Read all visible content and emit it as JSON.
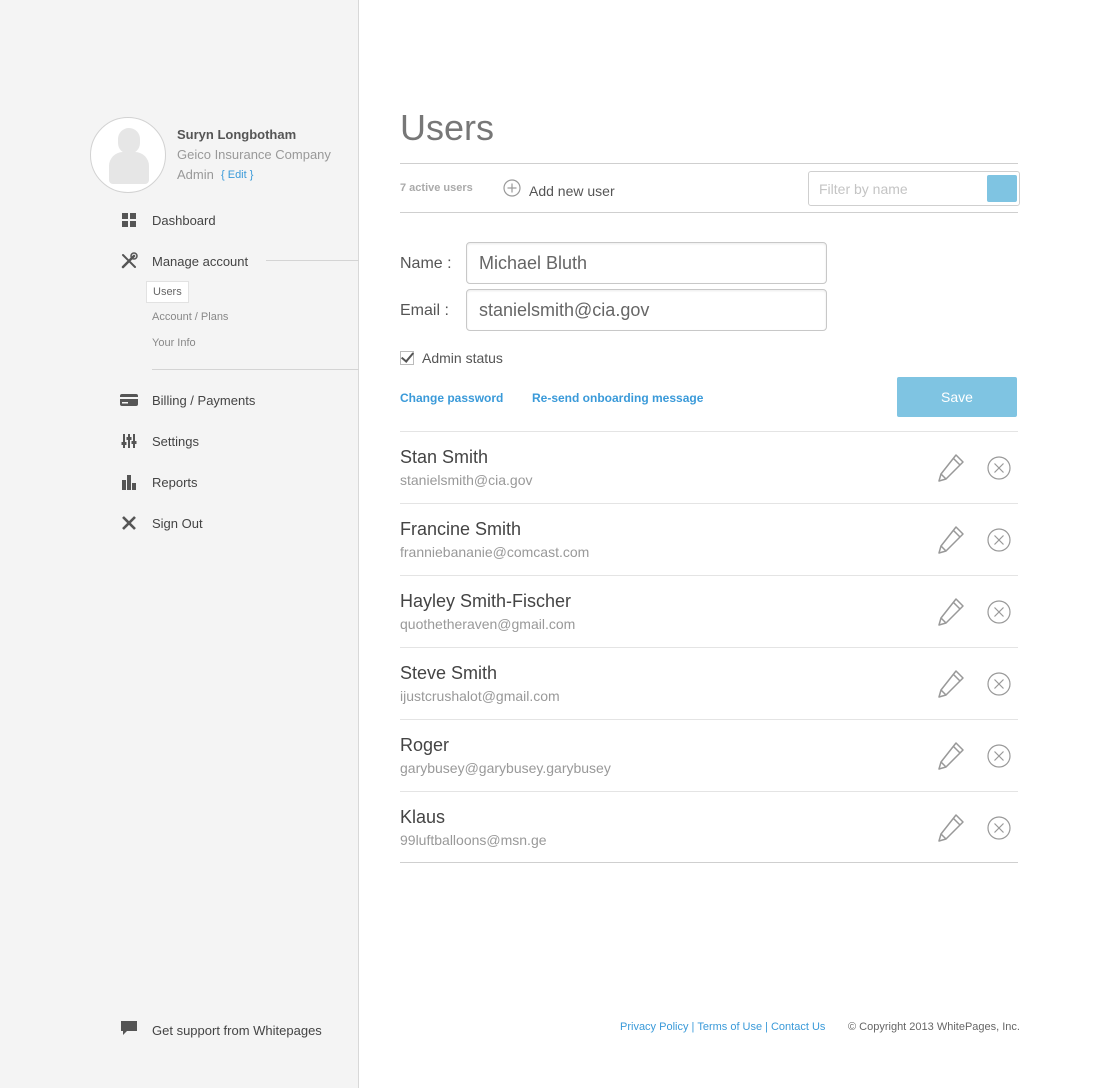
{
  "profile": {
    "name": "Suryn Longbotham",
    "company": "Geico Insurance Company",
    "role": "Admin",
    "edit_label": "{ Edit }"
  },
  "nav": {
    "dashboard": "Dashboard",
    "manage_account": "Manage account",
    "sub_items": [
      "Users",
      "Account / Plans",
      "Your Info"
    ],
    "billing": "Billing / Payments",
    "settings": "Settings",
    "reports": "Reports",
    "sign_out": "Sign Out",
    "support": "Get support from Whitepages"
  },
  "page": {
    "title": "Users",
    "active_count": "7 active users",
    "add_user_label": "Add new user",
    "filter_placeholder": "Filter by name"
  },
  "form": {
    "name_label": "Name :",
    "name_value": "Michael Bluth",
    "email_label": "Email :",
    "email_value": "stanielsmith@cia.gov",
    "admin_label": "Admin status",
    "admin_checked": true,
    "change_password": "Change password",
    "resend_onboarding": "Re-send onboarding message",
    "save_label": "Save"
  },
  "users": [
    {
      "name": "Stan Smith",
      "email": "stanielsmith@cia.gov"
    },
    {
      "name": "Francine Smith",
      "email": "franniebananie@comcast.com"
    },
    {
      "name": "Hayley Smith-Fischer",
      "email": "quothetheraven@gmail.com"
    },
    {
      "name": "Steve Smith",
      "email": "ijustcrushalot@gmail.com"
    },
    {
      "name": "Roger",
      "email": "garybusey@garybusey.garybusey"
    },
    {
      "name": "Klaus",
      "email": "99luftballoons@msn.ge"
    }
  ],
  "footer": {
    "privacy": "Privacy Policy",
    "terms": "Terms of Use",
    "contact": "Contact Us",
    "separator": "|",
    "copyright": "© Copyright 2013 WhitePages, Inc."
  },
  "colors": {
    "accent": "#3a9ad9",
    "button": "#7fc4e2",
    "sidebar_bg": "#f4f4f4"
  }
}
